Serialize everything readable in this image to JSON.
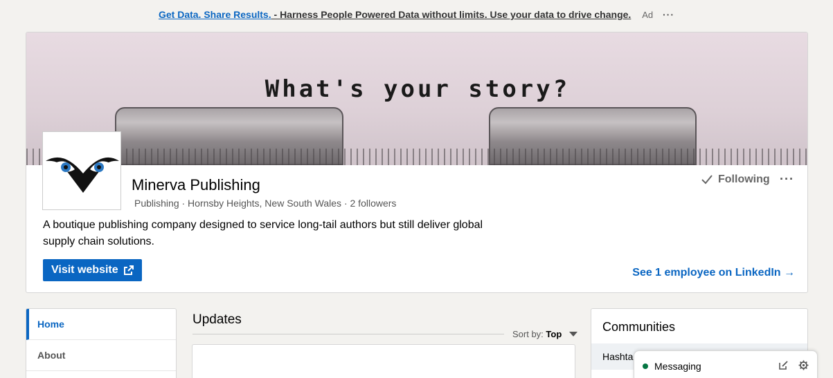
{
  "ad": {
    "link_text": "Get Data. Share Results.",
    "separator": " - ",
    "text": "Harness People Powered Data without limits. Use your data to drive change.",
    "label": "Ad",
    "more": "···"
  },
  "banner": {
    "text": "What's your story?"
  },
  "company": {
    "name": "Minerva Publishing",
    "meta": "Publishing · Hornsby Heights, New South Wales · 2 followers",
    "description": "A boutique publishing company designed to service long-tail authors but still deliver global supply chain solutions.",
    "visit_label": "Visit website",
    "following_label": "Following",
    "more": "···",
    "employees_link": "See 1 employee on LinkedIn →"
  },
  "nav": {
    "items": [
      {
        "label": "Home"
      },
      {
        "label": "About"
      }
    ]
  },
  "updates": {
    "title": "Updates",
    "sort_prefix": "Sort by:",
    "sort_value": "Top"
  },
  "communities": {
    "title": "Communities",
    "row": "Hashta"
  },
  "messaging": {
    "label": "Messaging"
  },
  "colors": {
    "brand_blue": "#0a66c2",
    "online_green": "#057642"
  }
}
